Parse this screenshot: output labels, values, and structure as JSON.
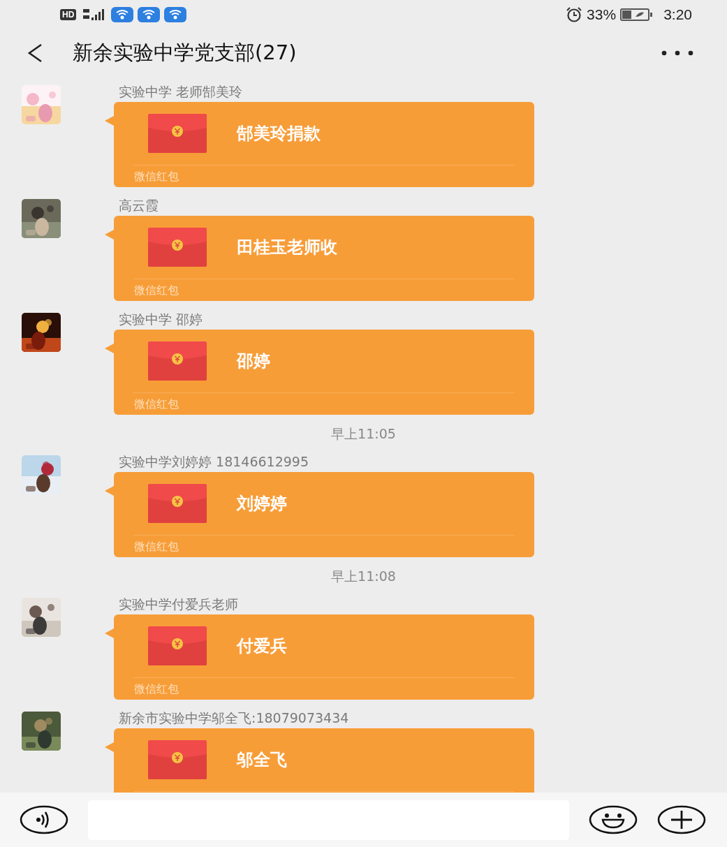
{
  "status_bar": {
    "hd": "HD",
    "battery": "33%",
    "time": "3:20"
  },
  "header": {
    "title": "新余实验中学党支部(27)"
  },
  "messages": [
    {
      "kind": "red_packet",
      "sender": "实验中学 老师郜美玲",
      "title": "郜美玲捐款",
      "footer": "微信红包"
    },
    {
      "kind": "red_packet",
      "sender": "高云霞",
      "title": "田桂玉老师收",
      "footer": "微信红包"
    },
    {
      "kind": "red_packet",
      "sender": "实验中学 邵婷",
      "title": "邵婷",
      "footer": "微信红包"
    },
    {
      "kind": "time",
      "text": "早上11:05"
    },
    {
      "kind": "red_packet",
      "sender": "实验中学刘婷婷 18146612995",
      "title": "刘婷婷",
      "footer": "微信红包"
    },
    {
      "kind": "time",
      "text": "早上11:08"
    },
    {
      "kind": "red_packet",
      "sender": "实验中学付爱兵老师",
      "title": "付爱兵",
      "footer": "微信红包"
    },
    {
      "kind": "red_packet",
      "sender": "新余市实验中学邬全飞:18079073434",
      "title": "邬全飞"
    }
  ]
}
